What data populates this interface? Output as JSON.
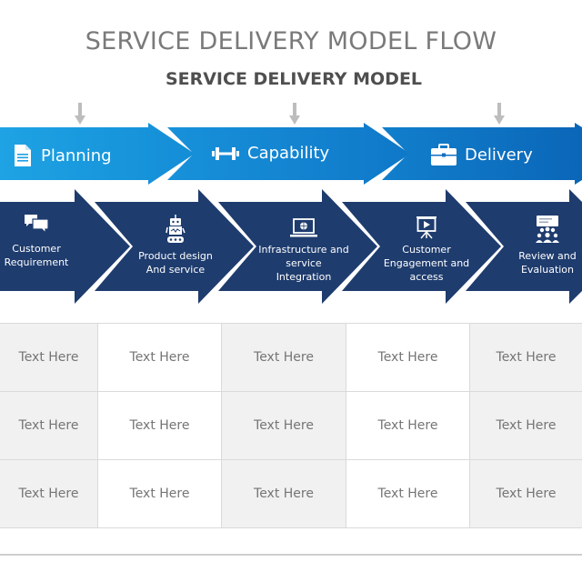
{
  "title": "SERVICE DELIVERY MODEL FLOW",
  "subtitle": "SERVICE DELIVERY MODEL",
  "colors": {
    "phase_light": "#1d9ce0",
    "phase_dark": "#0f6fc2",
    "step_navy": "#1e3c6e",
    "arrow_gray": "#bdbdbd",
    "cell_gray": "#f1f1f1",
    "cell_text": "#757575"
  },
  "phases": [
    {
      "label": "Planning",
      "icon": "document-icon"
    },
    {
      "label": "Capability",
      "icon": "dumbbell-icon"
    },
    {
      "label": "Delivery",
      "icon": "briefcase-icon"
    }
  ],
  "steps": [
    {
      "label_lines": [
        "Customer",
        "Requirement"
      ],
      "icon": "chat-bubbles-icon"
    },
    {
      "label_lines": [
        "Product design",
        "And service"
      ],
      "icon": "robot-icon"
    },
    {
      "label_lines": [
        "Infrastructure and",
        "service",
        "Integration"
      ],
      "icon": "laptop-globe-icon"
    },
    {
      "label_lines": [
        "Customer",
        "Engagement and",
        "access"
      ],
      "icon": "presentation-board-icon"
    },
    {
      "label_lines": [
        "Review and",
        "Evaluation"
      ],
      "icon": "team-meeting-icon"
    }
  ],
  "table": {
    "rows": [
      [
        "Text Here",
        "Text Here",
        "Text Here",
        "Text Here",
        "Text Here"
      ],
      [
        "Text Here",
        "Text Here",
        "Text Here",
        "Text Here",
        "Text Here"
      ],
      [
        "Text Here",
        "Text Here",
        "Text Here",
        "Text Here",
        "Text Here"
      ]
    ]
  }
}
